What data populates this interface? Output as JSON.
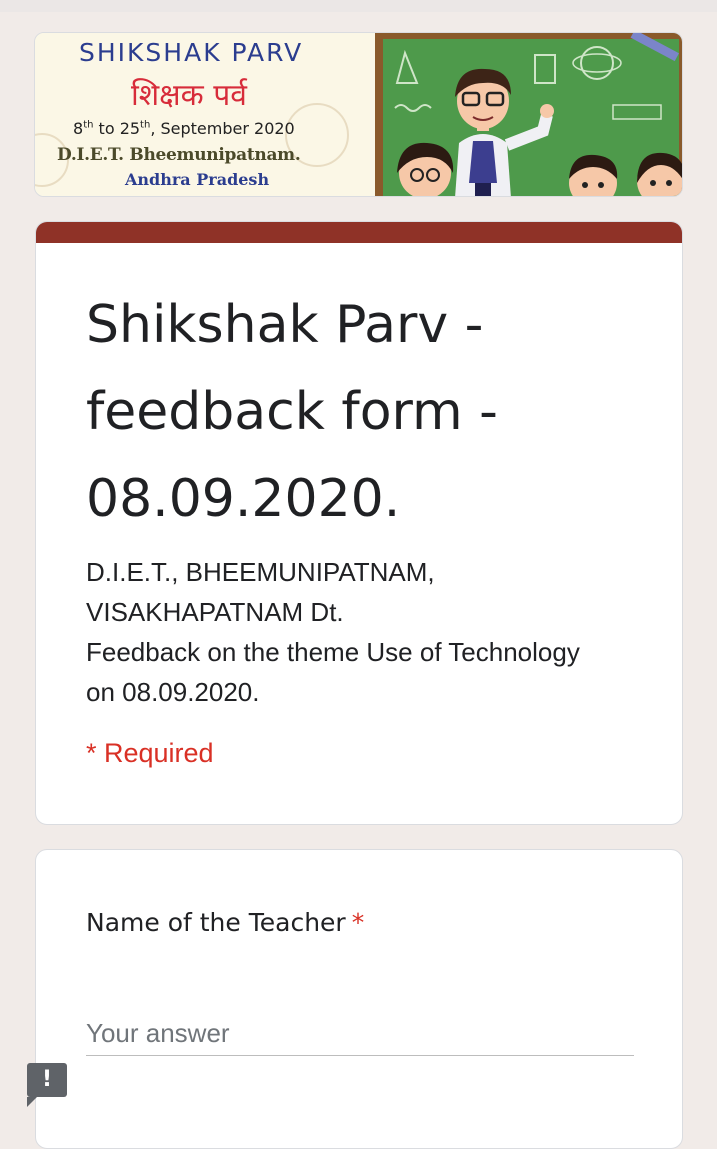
{
  "banner": {
    "title_en": "SHIKSHAK PARV",
    "title_hi": "शिक्षक पर्व",
    "dates_start": "8",
    "dates_start_sup": "th",
    "dates_mid": " to 25",
    "dates_end_sup": "th",
    "dates_rest": ", September 2020",
    "institution": "D.I.E.T. Bheemunipatnam.",
    "state": "Andhra Pradesh"
  },
  "form": {
    "title": "Shikshak Parv - feedback form - 08.09.2020.",
    "description_lines": [
      "D.I.E.T., BHEEMUNIPATNAM,",
      "VISAKHAPATNAM Dt.",
      "Feedback on the theme Use of Technology",
      "on 08.09.2020."
    ],
    "required_note": "* Required"
  },
  "question": {
    "title": "Name of the Teacher",
    "asterisk": "*",
    "placeholder": "Your answer"
  },
  "report": {
    "icon": "!"
  },
  "colors": {
    "page_background": "#f1ebe8",
    "accent": "#8f3227",
    "required": "#d93025",
    "text": "#202124",
    "placeholder": "#70757a",
    "report_button": "#5f6368"
  }
}
